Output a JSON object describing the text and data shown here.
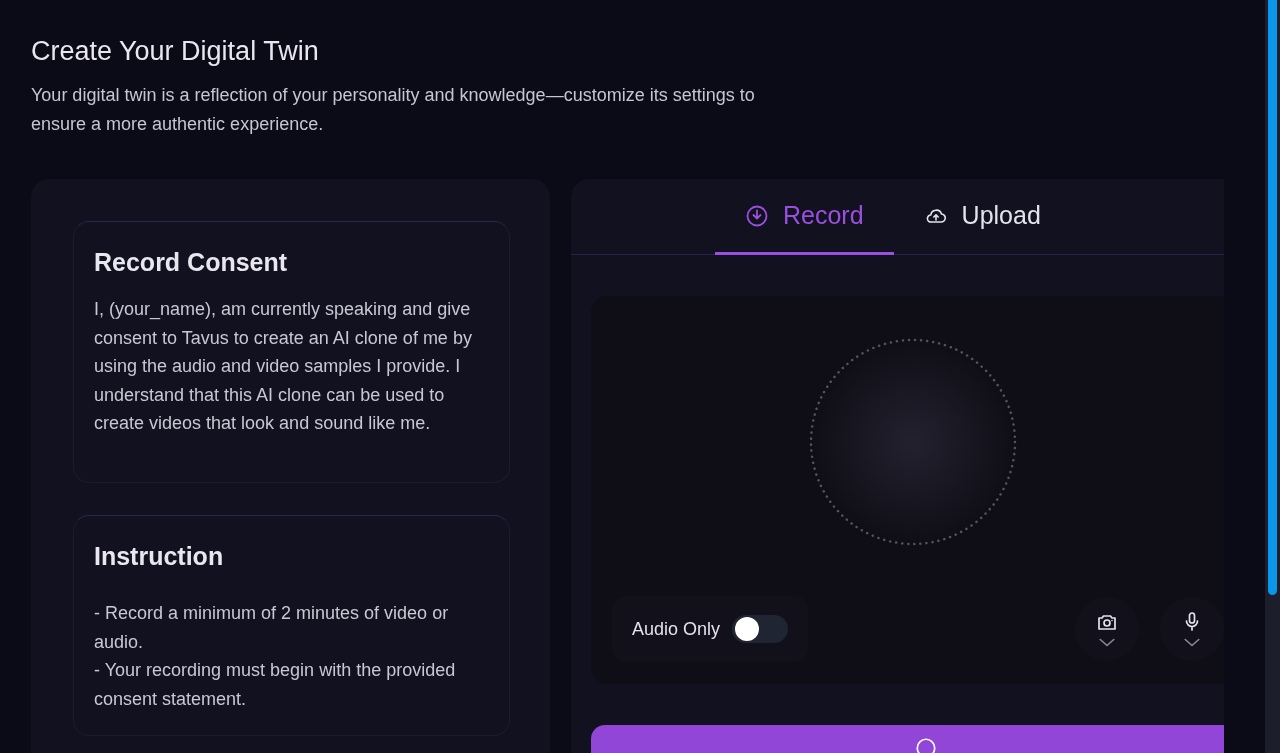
{
  "header": {
    "title": "Create Your Digital Twin",
    "description": "Your digital twin is a reflection of your personality and knowledge—customize its settings to ensure a more authentic experience."
  },
  "cards": [
    {
      "title": "Record Consent",
      "paragraphs": [
        "I, (your_name), am currently speaking and give consent to Tavus to create an AI clone of me by using the audio and video samples I provide. I understand that this AI clone can be used to create videos that look and sound like me."
      ]
    },
    {
      "title": "Instruction",
      "paragraphs": [
        "- Record a minimum of 2 minutes of video or audio.",
        "- Your recording must begin with the provided consent statement."
      ]
    }
  ],
  "tabs": [
    {
      "label": "Record",
      "kind": "record",
      "selected": true
    },
    {
      "label": "Upload",
      "kind": "upload",
      "selected": false
    }
  ],
  "audio_only": {
    "label": "Audio Only",
    "on": false
  },
  "devices": [
    {
      "kind": "camera"
    },
    {
      "kind": "microphone"
    }
  ]
}
